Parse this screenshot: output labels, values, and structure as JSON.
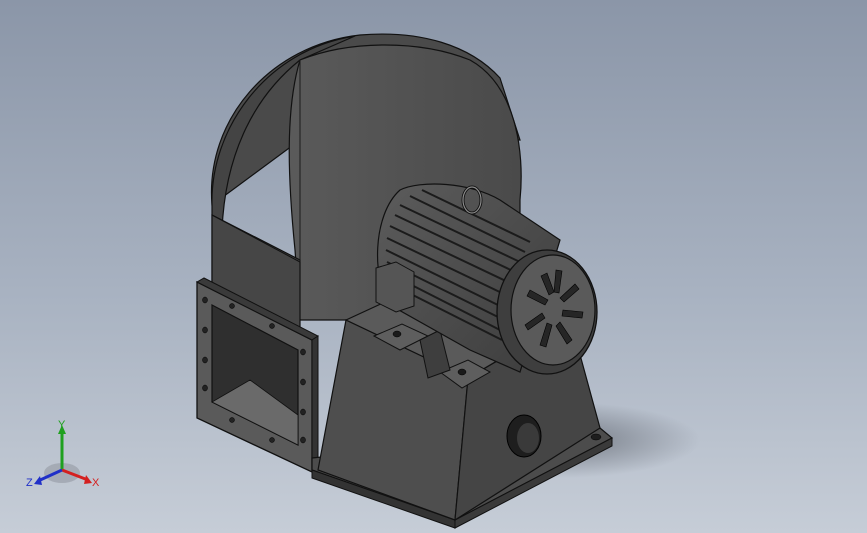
{
  "viewport": {
    "background_top": "#8b96a8",
    "background_bottom": "#c6cdd7"
  },
  "model": {
    "body_color": "#4e4e4e",
    "dark_color": "#2e2e2e",
    "edge_color": "#111111"
  },
  "triad": {
    "x_label": "X",
    "y_label": "Y",
    "z_label": "Z",
    "x_color": "#d42020",
    "y_color": "#1fa01f",
    "z_color": "#2030c8"
  }
}
